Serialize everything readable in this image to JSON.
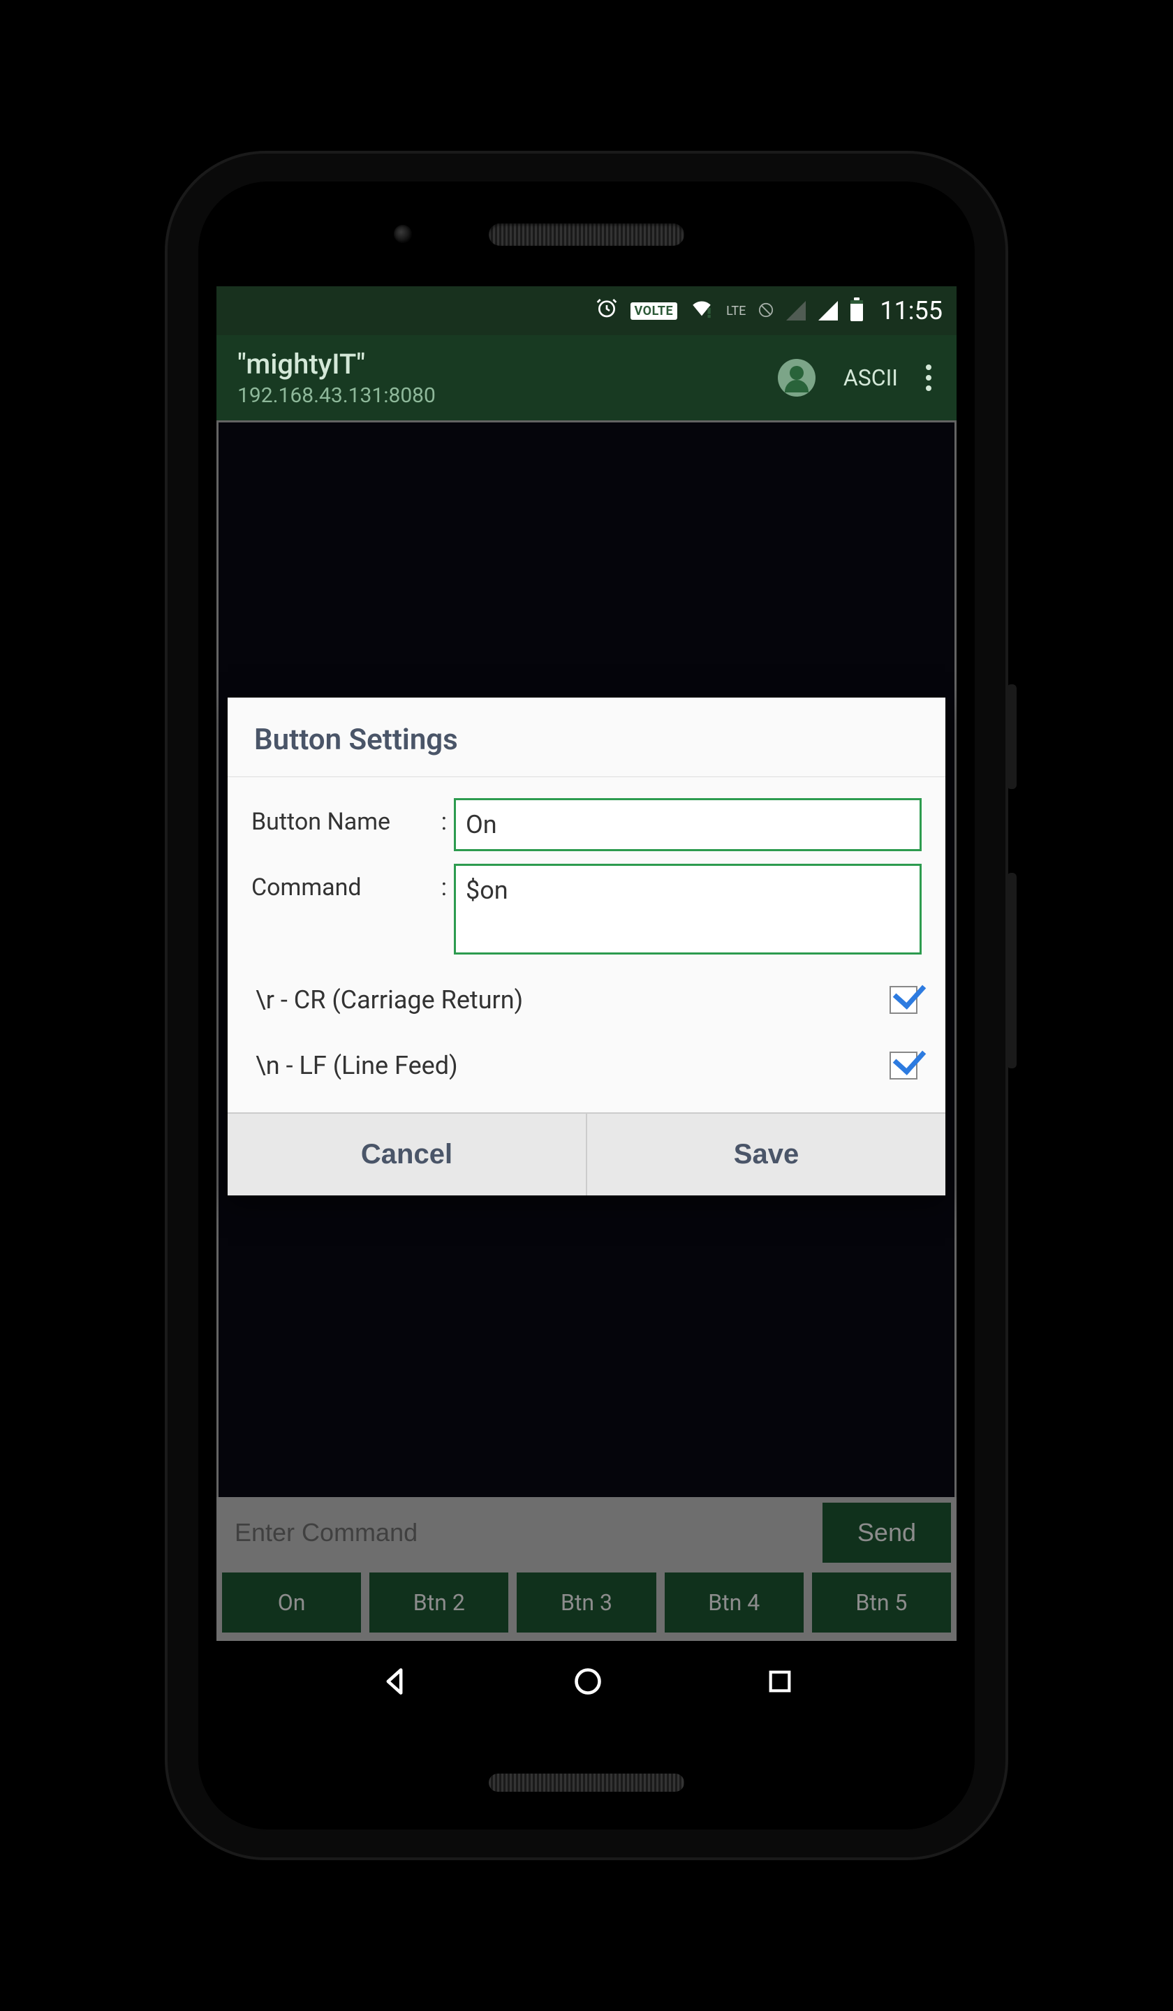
{
  "status": {
    "time": "11:55",
    "volte": "VOLTE",
    "lte": "LTE"
  },
  "appbar": {
    "title": "\"mightyIT\"",
    "subtitle": "192.168.43.131:8080",
    "mode": "ASCII"
  },
  "command": {
    "placeholder": "Enter Command",
    "send": "Send"
  },
  "macros": [
    "On",
    "Btn 2",
    "Btn 3",
    "Btn 4",
    "Btn 5"
  ],
  "dialog": {
    "title": "Button Settings",
    "name_label": "Button Name",
    "name_value": "On",
    "cmd_label": "Command",
    "cmd_value": "$on",
    "cr_label": "\\r - CR (Carriage Return)",
    "lf_label": "\\n - LF (Line Feed)",
    "cancel": "Cancel",
    "save": "Save"
  }
}
